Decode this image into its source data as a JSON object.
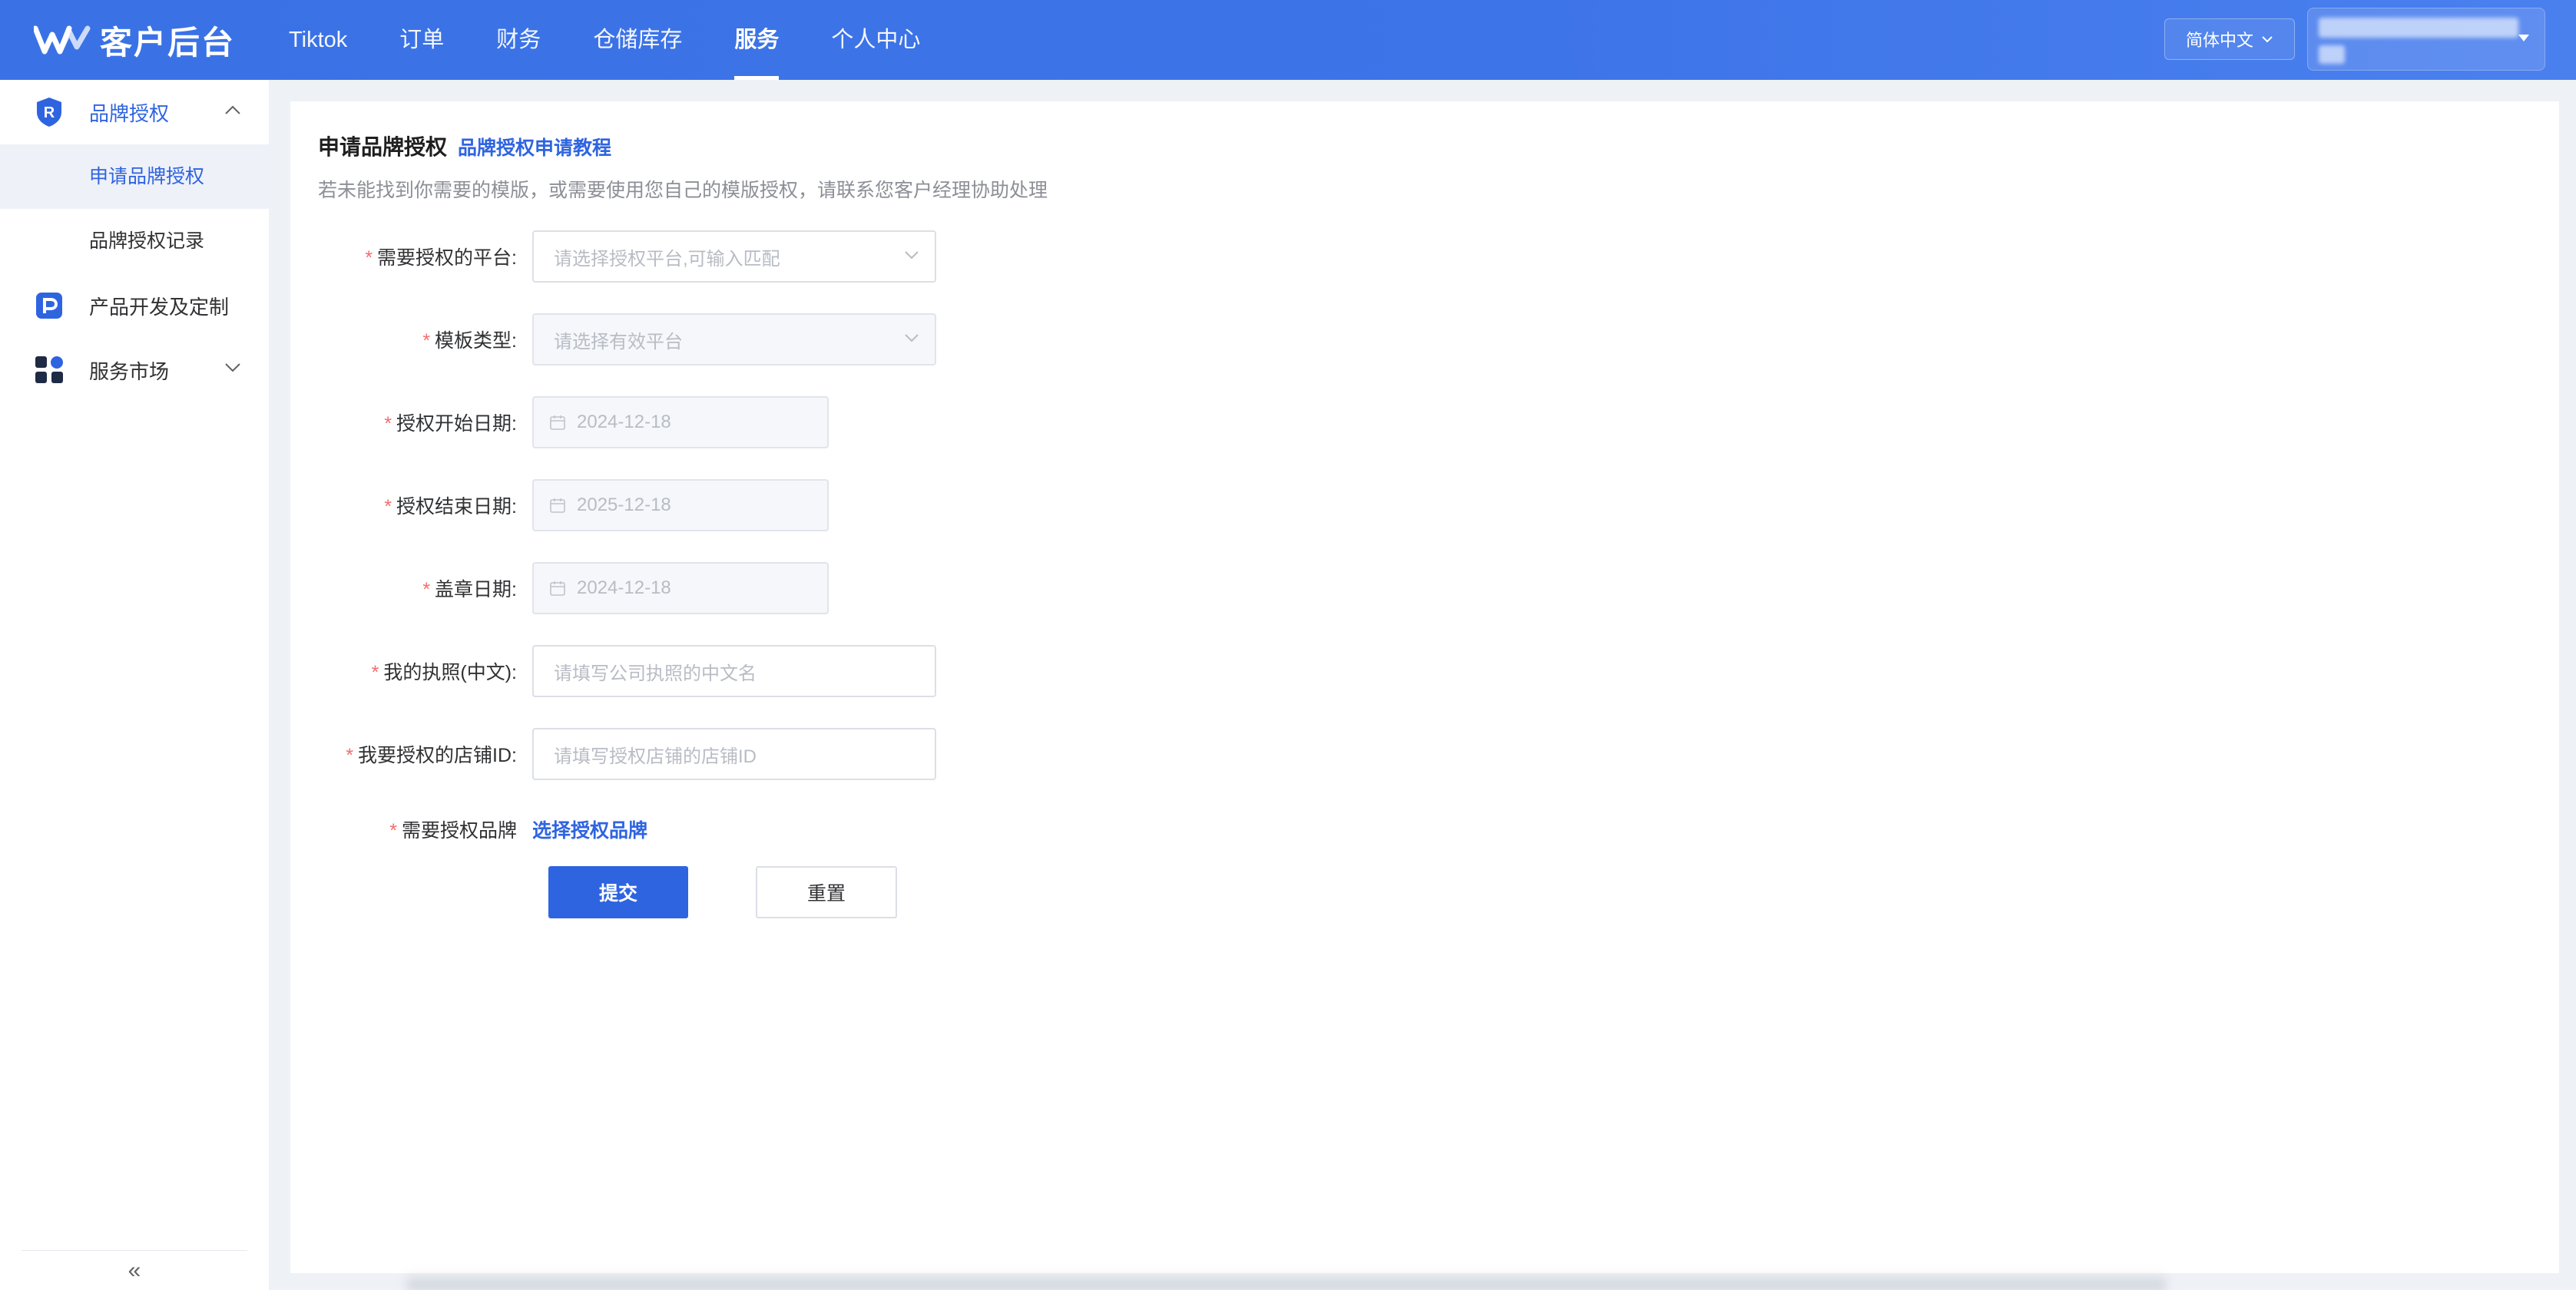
{
  "brand": {
    "name": "客户后台",
    "logo_icon": "wm-logo-icon"
  },
  "nav": {
    "items": [
      {
        "label": "Tiktok",
        "active": false
      },
      {
        "label": "订单",
        "active": false
      },
      {
        "label": "财务",
        "active": false
      },
      {
        "label": "仓储库存",
        "active": false
      },
      {
        "label": "服务",
        "active": true
      },
      {
        "label": "个人中心",
        "active": false
      }
    ]
  },
  "header": {
    "language": "简体中文"
  },
  "sidebar": {
    "groups": [
      {
        "label": "品牌授权",
        "icon": "shield-r-icon",
        "expanded": true
      },
      {
        "label": "产品开发及定制",
        "icon": "p-badge-icon"
      },
      {
        "label": "服务市场",
        "icon": "apps-grid-icon",
        "expanded": false
      }
    ],
    "sub_items": [
      {
        "label": "申请品牌授权",
        "active": true
      },
      {
        "label": "品牌授权记录",
        "active": false
      }
    ],
    "collapse_icon": "double-chevron-left-icon",
    "collapse_glyph": "«"
  },
  "page": {
    "title": "申请品牌授权",
    "tutorial_link": "品牌授权申请教程",
    "hint": "若未能找到你需要的模版，或需要使用您自己的模版授权，请联系您客户经理协助处理"
  },
  "form": {
    "required_mark": "*",
    "platform": {
      "label": "需要授权的平台:",
      "placeholder": "请选择授权平台,可输入匹配"
    },
    "template_type": {
      "label": "模板类型:",
      "placeholder": "请选择有效平台"
    },
    "start_date": {
      "label": "授权开始日期:",
      "value": "2024-12-18"
    },
    "end_date": {
      "label": "授权结束日期:",
      "value": "2025-12-18"
    },
    "seal_date": {
      "label": "盖章日期:",
      "value": "2024-12-18"
    },
    "license_cn": {
      "label": "我的执照(中文):",
      "placeholder": "请填写公司执照的中文名"
    },
    "store_id": {
      "label": "我要授权的店铺ID:",
      "placeholder": "请填写授权店铺的店铺ID"
    },
    "brand": {
      "label": "需要授权品牌",
      "link": "选择授权品牌"
    },
    "submit_label": "提交",
    "reset_label": "重置"
  },
  "colors": {
    "primary": "#2f64e0",
    "header": "#3d74e8",
    "required": "#f56c6c"
  }
}
